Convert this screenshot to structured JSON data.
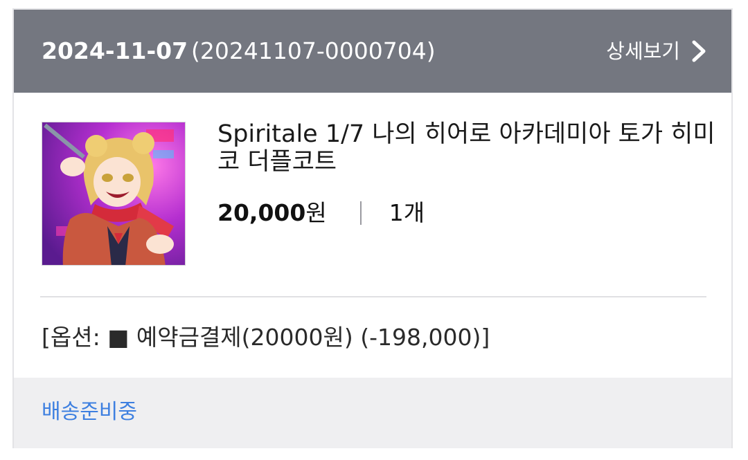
{
  "order": {
    "date": "2024-11-07",
    "number": "(20241107-0000704)",
    "detail_label": "상세보기"
  },
  "product": {
    "name": "Spiritale 1/7 나의 히어로 아카데미아 토가 히미코 더플코트",
    "price": "20,000",
    "price_unit": "원",
    "quantity": "1개",
    "image_icon": "product-figure-image"
  },
  "option_text": "[옵션: ■ 예약금결제(20000원) (-198,000)]",
  "status": "배송준비중",
  "colors": {
    "header_bg": "#747780",
    "status_blue": "#3d7fe0",
    "footer_bg": "#efeff1"
  }
}
